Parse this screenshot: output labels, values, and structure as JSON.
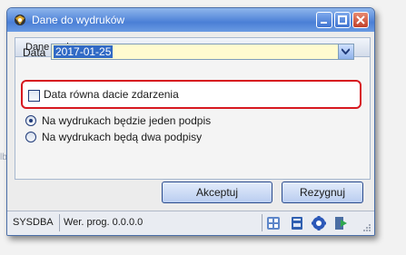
{
  "window": {
    "title": "Dane do wydruków"
  },
  "panel": {
    "title": "Dane podstawowe"
  },
  "date": {
    "label": "Data",
    "value": "2017-01-25"
  },
  "checkbox": {
    "label": "Data równa dacie zdarzenia",
    "checked": false
  },
  "radios": [
    {
      "label": "Na wydrukach będzie jeden podpis",
      "selected": true
    },
    {
      "label": "Na wydrukach będą dwa podpisy",
      "selected": false
    }
  ],
  "buttons": {
    "accept": "Akceptuj",
    "cancel": "Rezygnuj"
  },
  "status": {
    "user": "SYSDBA",
    "version": "Wer. prog. 0.0.0.0"
  },
  "colors": {
    "highlight": "#d71920",
    "title_bar": "#4a7fd6",
    "date_field": "#fffbd0"
  },
  "icons": [
    "calculator-icon",
    "book-icon",
    "gear-icon",
    "exit-icon"
  ]
}
